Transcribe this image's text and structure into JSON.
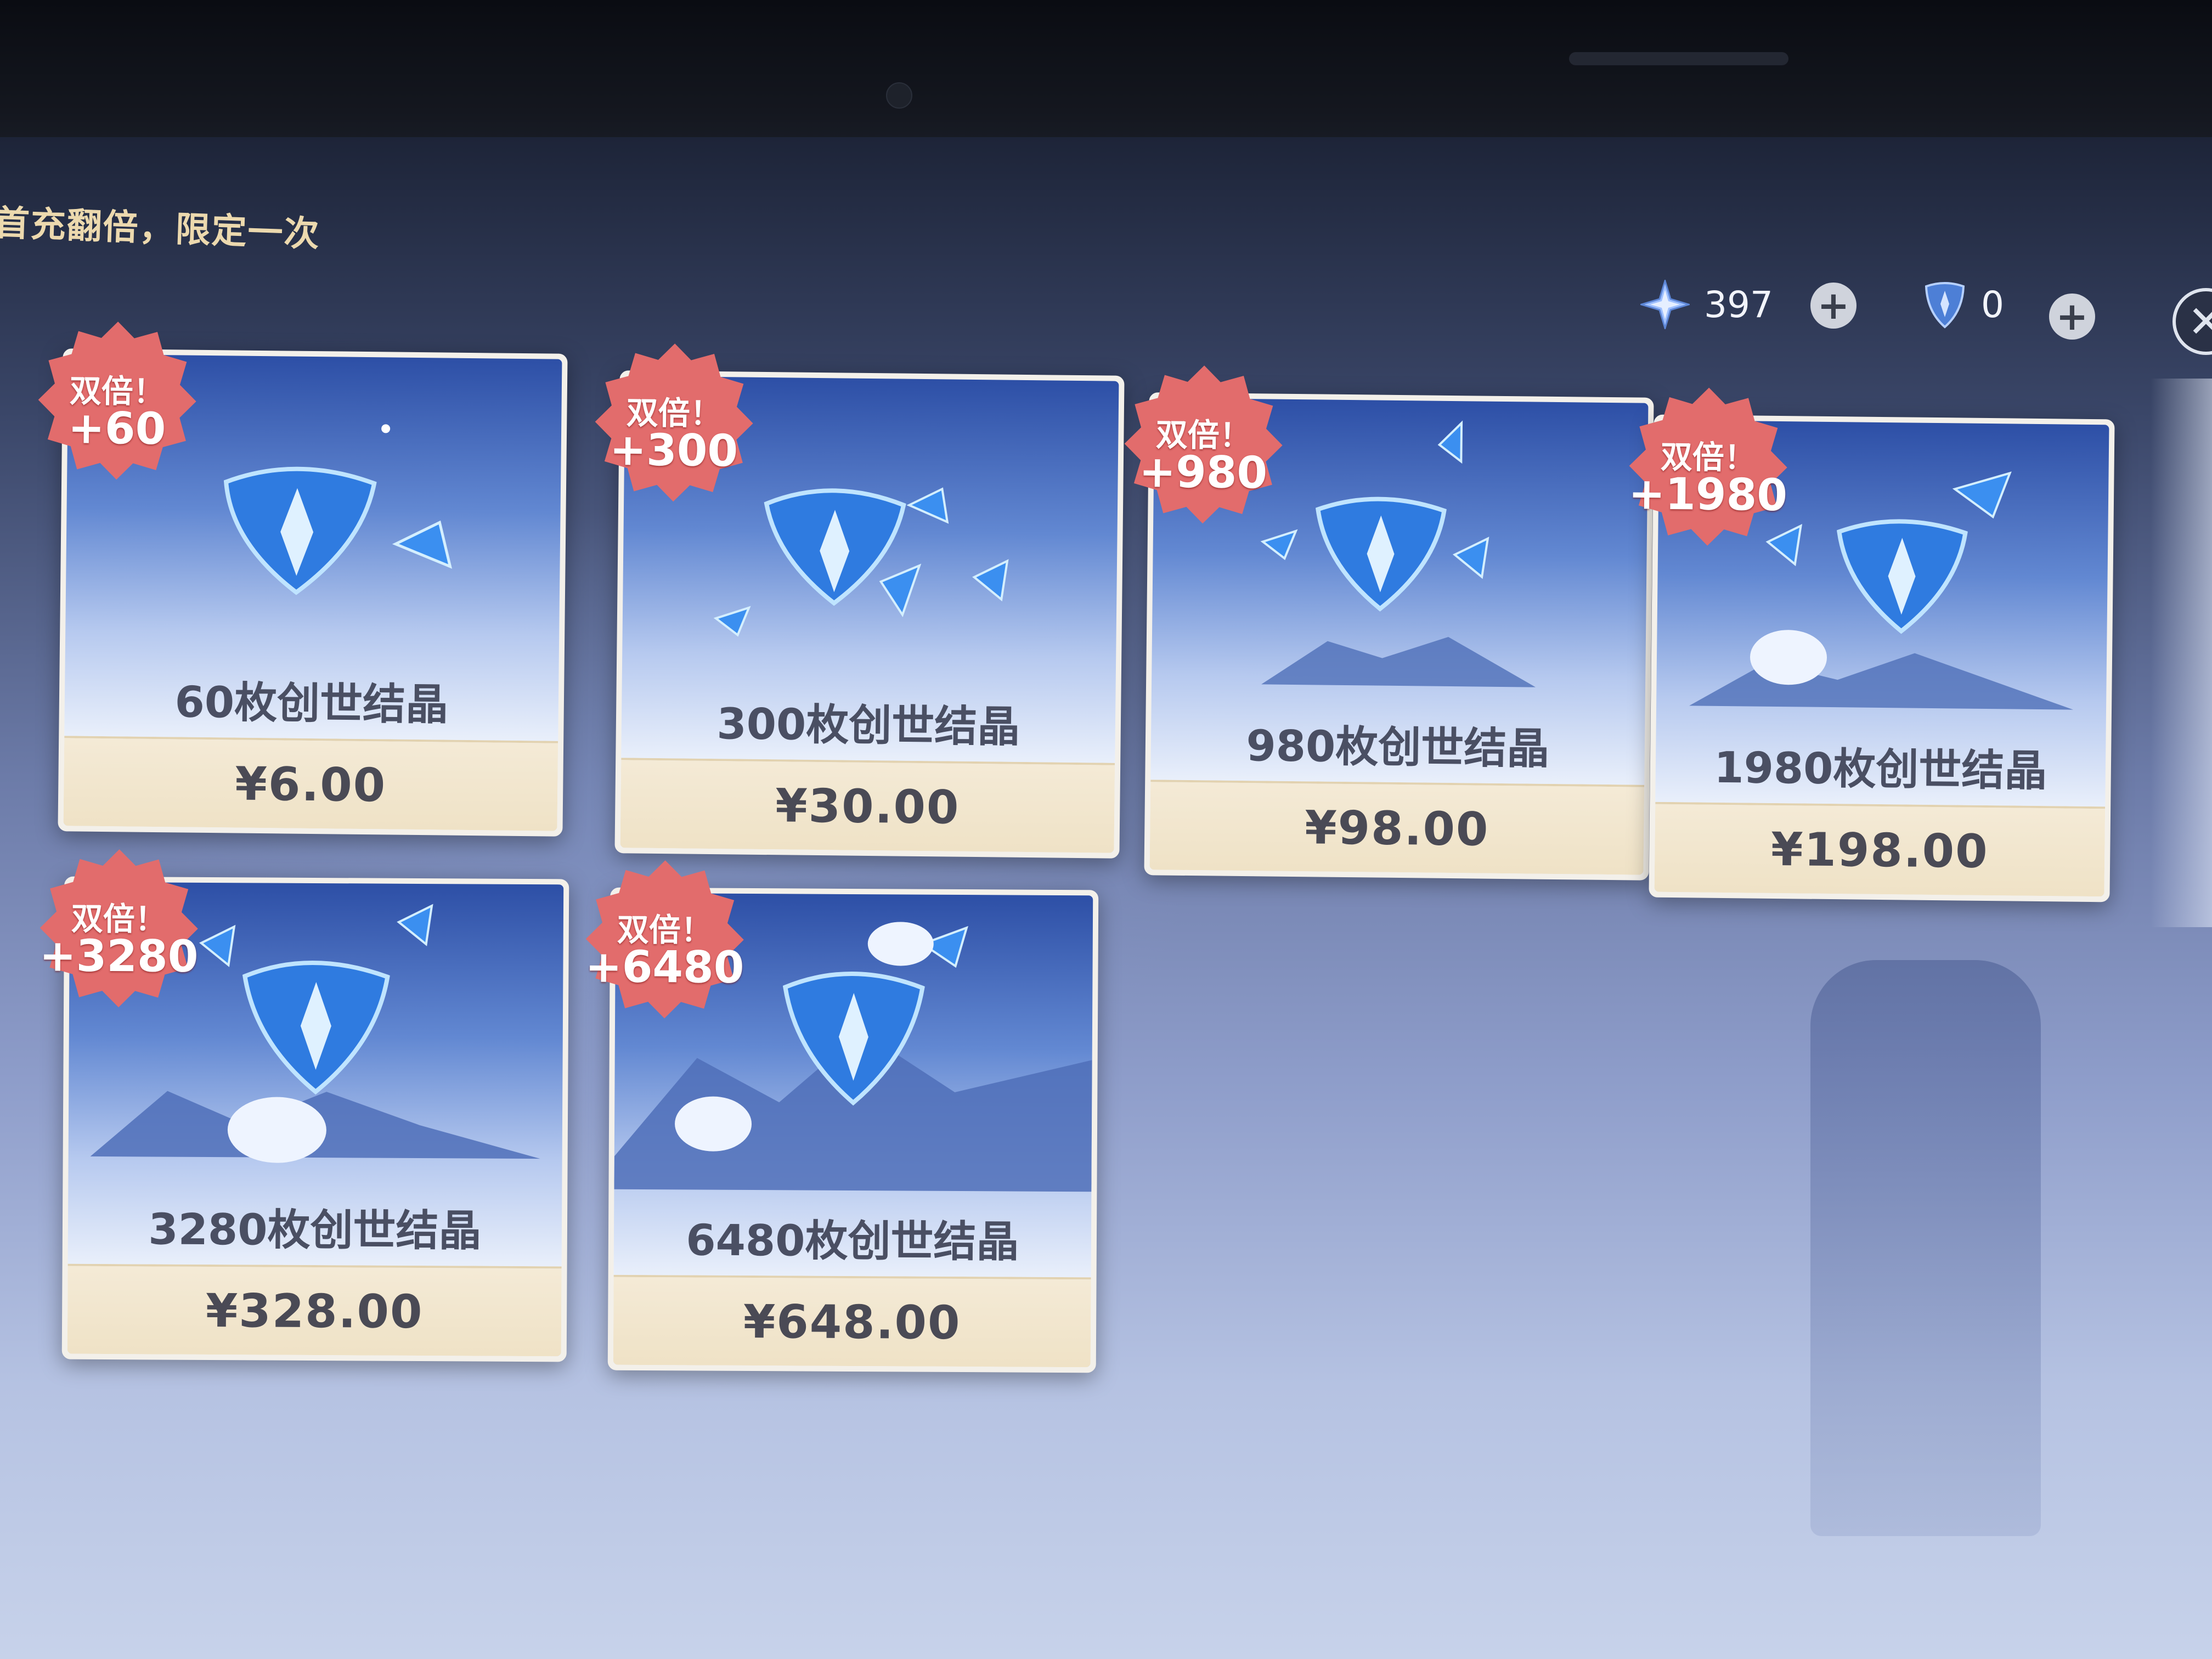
{
  "header": {
    "subtitle": "首充翻倍，限定一次"
  },
  "currency": {
    "primogem": {
      "icon": "primogem-icon",
      "value": "397"
    },
    "genesis": {
      "icon": "genesis-crystal-icon",
      "value": "0"
    }
  },
  "cards": [
    {
      "badge_label": "双倍！",
      "badge_amount": "+60",
      "name": "60枚创世结晶",
      "price": "¥6.00"
    },
    {
      "badge_label": "双倍！",
      "badge_amount": "+300",
      "name": "300枚创世结晶",
      "price": "¥30.00"
    },
    {
      "badge_label": "双倍！",
      "badge_amount": "+980",
      "name": "980枚创世结晶",
      "price": "¥98.00"
    },
    {
      "badge_label": "双倍！",
      "badge_amount": "+1980",
      "name": "1980枚创世结晶",
      "price": "¥198.00"
    },
    {
      "badge_label": "双倍！",
      "badge_amount": "+3280",
      "name": "3280枚创世结晶",
      "price": "¥328.00"
    },
    {
      "badge_label": "双倍！",
      "badge_amount": "+6480",
      "name": "6480枚创世结晶",
      "price": "¥648.00"
    }
  ],
  "colors": {
    "badge_red": "#e26c6c",
    "title_gold": "#ecd9ae",
    "price_bar": "#f1e6cf"
  }
}
